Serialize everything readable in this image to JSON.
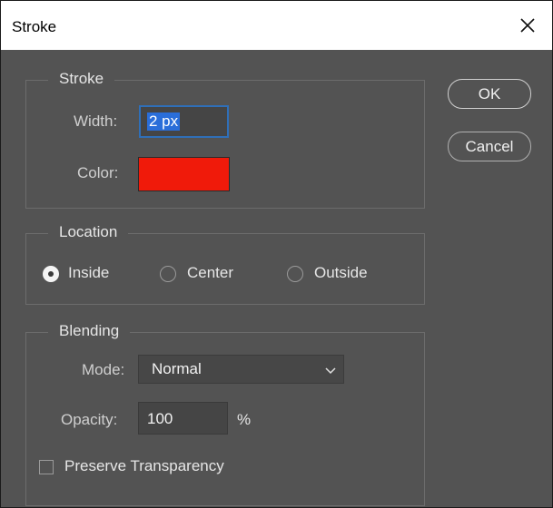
{
  "window": {
    "title": "Stroke",
    "close_icon": "close-icon"
  },
  "stroke_group": {
    "legend": "Stroke",
    "width_label": "Width:",
    "width_value": "2 px",
    "color_label": "Color:",
    "color_value": "#f01a0a"
  },
  "location_group": {
    "legend": "Location",
    "options": [
      {
        "label": "Inside",
        "selected": true
      },
      {
        "label": "Center",
        "selected": false
      },
      {
        "label": "Outside",
        "selected": false
      }
    ]
  },
  "blending_group": {
    "legend": "Blending",
    "mode_label": "Mode:",
    "mode_value": "Normal",
    "opacity_label": "Opacity:",
    "opacity_value": "100",
    "opacity_unit": "%",
    "preserve_label": "Preserve Transparency",
    "preserve_checked": false
  },
  "buttons": {
    "ok": "OK",
    "cancel": "Cancel"
  },
  "colors": {
    "dialog_bg": "#535353",
    "focus_ring": "#2f6fb8",
    "selection": "#2a6ed9"
  }
}
